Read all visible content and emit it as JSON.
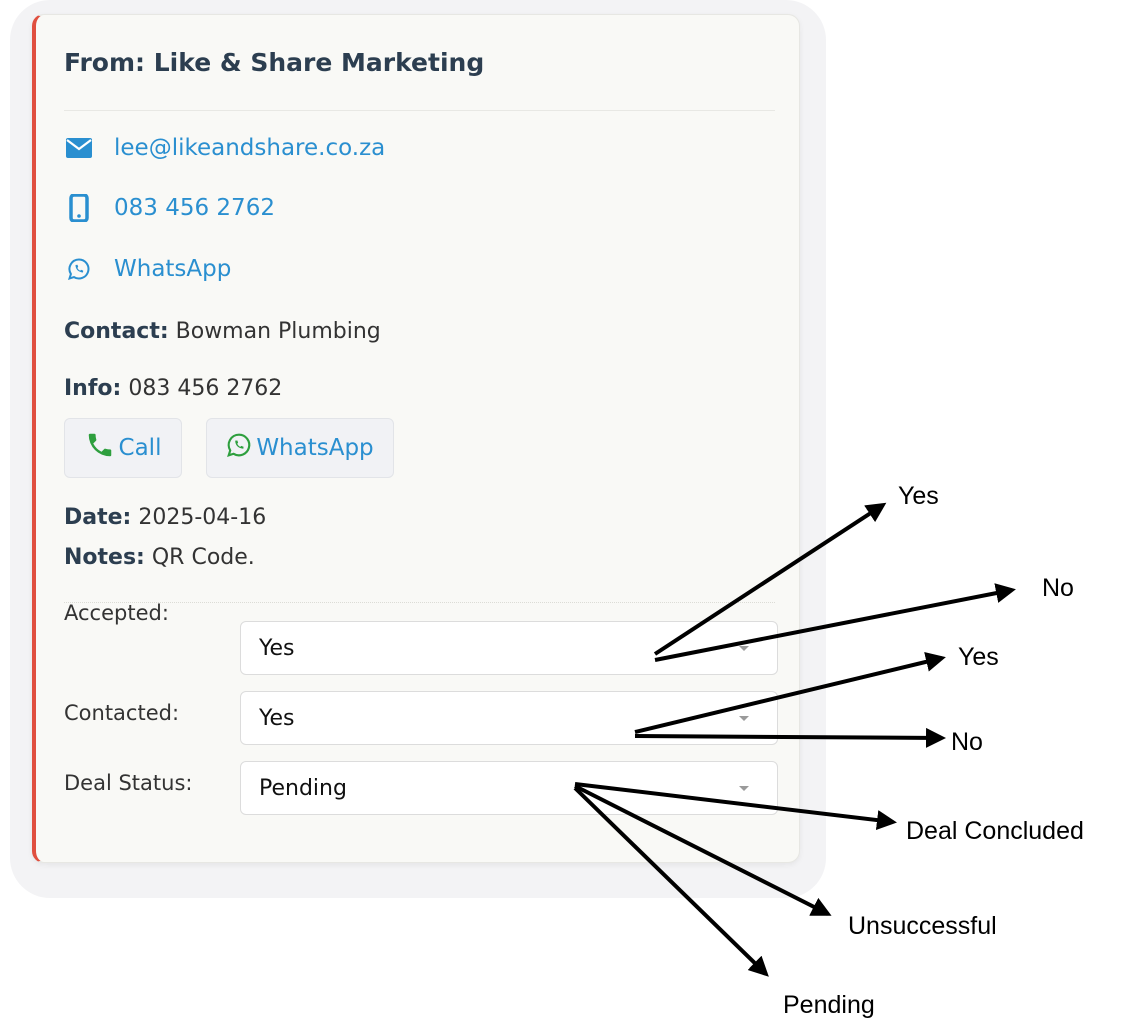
{
  "card": {
    "title": "From: Like & Share Marketing",
    "email": "lee@likeandshare.co.za",
    "phone": "083 456 2762",
    "whatsapp_link": "WhatsApp",
    "contact_label": "Contact:",
    "contact_value": "Bowman Plumbing",
    "info_label": "Info:",
    "info_value": "083 456 2762",
    "call_button": "Call",
    "whatsapp_button": "WhatsApp",
    "date_label": "Date:",
    "date_value": "2025-04-16",
    "notes_label": "Notes:",
    "notes_value": "QR Code.",
    "accent_color": "#e04f3f",
    "link_color": "#2a8fd0"
  },
  "fields": {
    "accepted_label": "Accepted:",
    "accepted_value": "Yes",
    "contacted_label": "Contacted:",
    "contacted_value": "Yes",
    "deal_status_label": "Deal Status:",
    "deal_status_value": "Pending"
  },
  "annotations": {
    "accepted_options": [
      "Yes",
      "No"
    ],
    "contacted_options": [
      "Yes",
      "No"
    ],
    "deal_status_options": [
      "Deal Concluded",
      "Unsuccessful",
      "Pending"
    ]
  },
  "icons": {
    "email": "envelope-icon",
    "phone": "mobile-phone-icon",
    "whatsapp": "whatsapp-icon",
    "call": "phone-handset-icon"
  }
}
